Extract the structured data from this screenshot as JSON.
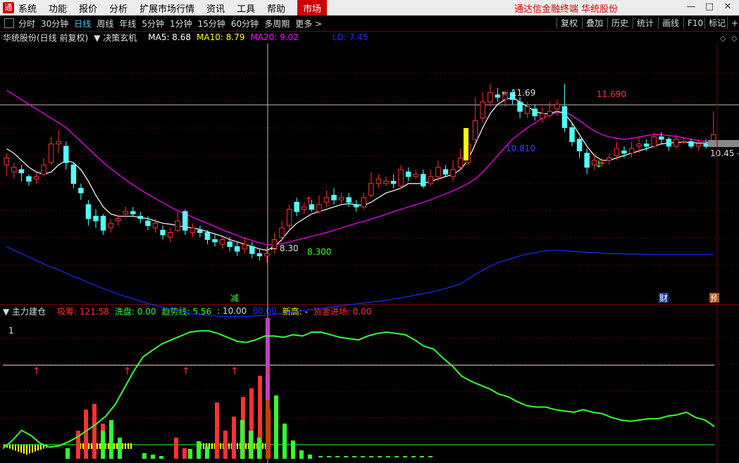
{
  "menu": {
    "items": [
      "系统",
      "功能",
      "报价",
      "分析",
      "扩展市场行情",
      "资讯",
      "工具",
      "帮助"
    ],
    "market": "市场",
    "brand": "通达信金融终端  华统股份"
  },
  "toolbar": {
    "periods": [
      "分时",
      "30分钟",
      "日线",
      "周线",
      "年线",
      "5分钟",
      "1分钟",
      "15分钟",
      "60分钟",
      "多周期",
      "更多 >"
    ],
    "active": "日线",
    "right_buttons": [
      "复权",
      "叠加",
      "历史",
      "统计",
      "画线",
      "F10",
      "标记",
      "+自"
    ]
  },
  "main_info": {
    "title": "华统股份(日线 前复权)",
    "indicator": "决策玄机",
    "ma5": "MA5: 8.68",
    "ma10": "MA10: 8.79",
    "ma20": "MA20: 9.02",
    "ld": "LD: 7.45"
  },
  "price_labels": {
    "high": "11.69",
    "high_red": "11.690",
    "low": "8.30",
    "low_green": "8.300",
    "mid_blue": "10.810",
    "last": "10.45 -",
    "marker_left": "减",
    "marker_cai": "财",
    "marker_yu": "预"
  },
  "sub_info": {
    "title": "主力建仓",
    "xichou": "吸筹: 121.58",
    "xipan": "洗盘: 0.00",
    "qushi": "趋势线: 5.56",
    "ten": ": 10.00",
    "eighty": "80.00",
    "xingao": "新高: -",
    "zijin": "资金进场: 0.00",
    "axis_one": "1"
  },
  "colors": {
    "up": "#ff3232",
    "down": "#54ffff",
    "ma_white": "#ffffff",
    "ma_magenta": "#ff00ff",
    "ld_blue": "#1a2cff",
    "trend_green": "#33ff33",
    "yellow": "#ffff00"
  },
  "chart_data": {
    "type": "candlestick",
    "price_range": [
      7.0,
      12.55
    ],
    "candles": [
      [
        9.95,
        10.1,
        10.2,
        9.7
      ],
      [
        9.8,
        9.9,
        10.0,
        9.65
      ],
      [
        9.85,
        9.78,
        9.95,
        9.6
      ],
      [
        9.7,
        9.6,
        9.75,
        9.5
      ],
      [
        9.65,
        9.7,
        9.8,
        9.55
      ],
      [
        9.75,
        9.95,
        10.1,
        9.7
      ],
      [
        10.0,
        10.4,
        10.55,
        9.95
      ],
      [
        10.4,
        10.45,
        10.7,
        10.2
      ],
      [
        10.35,
        10.0,
        10.45,
        9.85
      ],
      [
        9.95,
        9.55,
        10.0,
        9.45
      ],
      [
        9.45,
        9.35,
        9.55,
        9.2
      ],
      [
        9.1,
        8.8,
        9.2,
        8.65
      ],
      [
        8.85,
        8.75,
        9.0,
        8.6
      ],
      [
        8.85,
        8.55,
        8.9,
        8.45
      ],
      [
        8.6,
        8.7,
        8.8,
        8.5
      ],
      [
        8.75,
        8.8,
        8.9,
        8.65
      ],
      [
        8.9,
        8.95,
        9.05,
        8.8
      ],
      [
        8.95,
        8.9,
        9.05,
        8.85
      ],
      [
        8.85,
        8.8,
        8.95,
        8.7
      ],
      [
        8.75,
        8.65,
        8.85,
        8.55
      ],
      [
        8.6,
        8.7,
        8.8,
        8.5
      ],
      [
        8.55,
        8.45,
        8.65,
        8.35
      ],
      [
        8.4,
        8.5,
        8.6,
        8.3
      ],
      [
        8.55,
        8.75,
        8.95,
        8.5
      ],
      [
        8.95,
        8.55,
        9.0,
        8.45
      ],
      [
        8.5,
        8.6,
        8.7,
        8.4
      ],
      [
        8.55,
        8.5,
        8.65,
        8.4
      ],
      [
        8.5,
        8.35,
        8.55,
        8.25
      ],
      [
        8.35,
        8.3,
        8.45,
        8.2
      ],
      [
        8.25,
        8.35,
        8.4,
        8.15
      ],
      [
        8.3,
        8.2,
        8.4,
        8.1
      ],
      [
        8.2,
        8.1,
        8.3,
        8.0
      ],
      [
        8.15,
        8.25,
        8.4,
        8.05
      ],
      [
        8.2,
        8.05,
        8.3,
        7.95
      ],
      [
        8.05,
        8.0,
        8.15,
        7.9
      ],
      [
        8.0,
        8.05,
        8.2,
        7.85
      ],
      [
        8.15,
        8.35,
        8.5,
        8.05
      ],
      [
        8.4,
        8.6,
        8.75,
        8.3
      ],
      [
        8.65,
        9.0,
        9.1,
        8.55
      ],
      [
        9.15,
        8.95,
        9.25,
        8.85
      ],
      [
        9.0,
        9.05,
        9.15,
        8.9
      ],
      [
        9.1,
        9.0,
        9.2,
        8.95
      ],
      [
        8.95,
        9.1,
        9.3,
        8.9
      ],
      [
        9.15,
        9.25,
        9.4,
        9.05
      ],
      [
        9.3,
        9.2,
        9.45,
        9.1
      ],
      [
        9.2,
        9.25,
        9.35,
        9.1
      ],
      [
        9.25,
        9.15,
        9.35,
        9.05
      ],
      [
        9.1,
        9.05,
        9.2,
        8.95
      ],
      [
        9.05,
        9.25,
        9.35,
        9.0
      ],
      [
        9.3,
        9.55,
        9.8,
        9.25
      ],
      [
        9.55,
        9.65,
        9.75,
        9.45
      ],
      [
        9.55,
        9.6,
        9.7,
        9.5
      ],
      [
        9.6,
        9.55,
        9.75,
        9.45
      ],
      [
        9.5,
        9.85,
        9.95,
        9.45
      ],
      [
        9.8,
        9.7,
        9.9,
        9.6
      ],
      [
        9.7,
        9.75,
        9.85,
        9.65
      ],
      [
        9.75,
        9.5,
        9.85,
        9.45
      ],
      [
        9.55,
        9.7,
        9.85,
        9.5
      ],
      [
        9.7,
        9.9,
        10.05,
        9.6
      ],
      [
        9.85,
        9.75,
        9.95,
        9.7
      ],
      [
        9.7,
        9.85,
        10.05,
        9.6
      ],
      [
        9.9,
        10.1,
        10.3,
        9.85
      ],
      [
        10.0,
        10.4,
        10.65,
        9.95
      ],
      [
        10.5,
        10.9,
        11.4,
        10.4
      ],
      [
        10.95,
        11.3,
        11.5,
        10.85
      ],
      [
        11.3,
        11.5,
        11.69,
        11.2
      ],
      [
        11.45,
        11.4,
        11.6,
        11.3
      ],
      [
        11.35,
        11.45,
        11.55,
        11.2
      ],
      [
        11.5,
        11.35,
        11.55,
        11.25
      ],
      [
        11.3,
        11.1,
        11.4,
        10.95
      ],
      [
        11.05,
        11.2,
        11.3,
        10.95
      ],
      [
        11.15,
        11.0,
        11.25,
        10.9
      ],
      [
        10.95,
        11.05,
        11.2,
        10.85
      ],
      [
        11.0,
        11.1,
        11.3,
        10.95
      ],
      [
        11.15,
        11.25,
        11.35,
        11.0
      ],
      [
        11.2,
        10.75,
        11.69,
        10.65
      ],
      [
        10.75,
        10.45,
        10.85,
        10.35
      ],
      [
        10.5,
        10.25,
        10.55,
        10.1
      ],
      [
        10.2,
        9.9,
        10.3,
        9.75
      ],
      [
        9.95,
        10.05,
        10.2,
        9.85
      ],
      [
        10.0,
        10.0,
        10.1,
        9.9
      ],
      [
        10.05,
        10.1,
        10.2,
        9.95
      ],
      [
        10.15,
        10.3,
        10.45,
        10.05
      ],
      [
        10.25,
        10.2,
        10.35,
        10.1
      ],
      [
        10.2,
        10.3,
        10.45,
        10.1
      ],
      [
        10.35,
        10.4,
        10.55,
        10.2
      ],
      [
        10.4,
        10.35,
        10.5,
        10.25
      ],
      [
        10.35,
        10.55,
        10.65,
        10.3
      ],
      [
        10.55,
        10.5,
        10.65,
        10.4
      ],
      [
        10.5,
        10.35,
        10.55,
        10.25
      ],
      [
        10.35,
        10.5,
        10.6,
        10.3
      ],
      [
        10.45,
        10.45,
        10.55,
        10.4
      ],
      [
        10.45,
        10.35,
        10.5,
        10.3
      ],
      [
        10.35,
        10.4,
        10.5,
        10.25
      ],
      [
        10.4,
        10.35,
        10.5,
        10.3
      ],
      [
        10.4,
        10.6,
        11.1,
        10.4
      ]
    ],
    "ma_white": [
      10.3,
      10.2,
      10.05,
      9.9,
      9.8,
      9.75,
      9.8,
      9.95,
      10.05,
      10.0,
      9.85,
      9.6,
      9.3,
      9.05,
      8.9,
      8.85,
      8.85,
      8.85,
      8.82,
      8.8,
      8.75,
      8.7,
      8.68,
      8.65,
      8.62,
      8.6,
      8.57,
      8.52,
      8.47,
      8.42,
      8.35,
      8.3,
      8.25,
      8.2,
      8.15,
      8.12,
      8.2,
      8.35,
      8.55,
      8.7,
      8.8,
      8.9,
      8.95,
      9.0,
      9.05,
      9.1,
      9.12,
      9.1,
      9.08,
      9.15,
      9.25,
      9.35,
      9.4,
      9.45,
      9.55,
      9.55,
      9.55,
      9.6,
      9.65,
      9.7,
      9.75,
      9.85,
      10.05,
      10.4,
      10.75,
      11.05,
      11.25,
      11.35,
      11.4,
      11.3,
      11.2,
      11.1,
      11.05,
      11.05,
      11.1,
      11.05,
      10.85,
      10.6,
      10.35,
      10.15,
      10.05,
      10.05,
      10.1,
      10.15,
      10.2,
      10.25,
      10.3,
      10.35,
      10.4,
      10.42,
      10.43,
      10.44,
      10.43,
      10.42,
      10.42,
      10.45
    ],
    "ma_magenta": [
      11.55,
      11.45,
      11.35,
      11.25,
      11.15,
      11.05,
      10.95,
      10.85,
      10.75,
      10.6,
      10.45,
      10.3,
      10.15,
      10.0,
      9.87,
      9.75,
      9.63,
      9.52,
      9.42,
      9.32,
      9.23,
      9.14,
      9.05,
      8.97,
      8.9,
      8.83,
      8.76,
      8.7,
      8.63,
      8.56,
      8.5,
      8.44,
      8.38,
      8.33,
      8.28,
      8.24,
      8.24,
      8.26,
      8.3,
      8.34,
      8.38,
      8.42,
      8.46,
      8.5,
      8.55,
      8.6,
      8.65,
      8.7,
      8.74,
      8.79,
      8.84,
      8.89,
      8.95,
      9.0,
      9.05,
      9.1,
      9.15,
      9.2,
      9.27,
      9.33,
      9.4,
      9.47,
      9.55,
      9.65,
      9.8,
      9.97,
      10.15,
      10.33,
      10.5,
      10.63,
      10.75,
      10.85,
      10.95,
      11.03,
      11.07,
      11.1,
      11.0,
      10.9,
      10.78,
      10.68,
      10.6,
      10.55,
      10.52,
      10.5,
      10.52,
      10.55,
      10.58,
      10.6,
      10.6,
      10.58,
      10.56,
      10.53,
      10.5,
      10.47,
      10.45,
      10.45
    ],
    "ld_blue": [
      8.2,
      8.12,
      8.05,
      7.98,
      7.9,
      7.83,
      7.76,
      7.7,
      7.63,
      7.56,
      7.5,
      7.43,
      7.36,
      7.3,
      7.24,
      7.18,
      7.13,
      7.08,
      7.03,
      6.98,
      6.94,
      6.9,
      6.86,
      6.82,
      6.79,
      6.76,
      6.74,
      6.72,
      6.71,
      6.7,
      6.7,
      6.7,
      6.7,
      6.71,
      6.72,
      6.73,
      6.75,
      6.77,
      6.79,
      6.81,
      6.83,
      6.85,
      6.87,
      6.89,
      6.91,
      6.93,
      6.95,
      6.97,
      6.99,
      7.01,
      7.03,
      7.05,
      7.08,
      7.1,
      7.13,
      7.16,
      7.19,
      7.22,
      7.26,
      7.3,
      7.35,
      7.4,
      7.5,
      7.6,
      7.7,
      7.78,
      7.85,
      7.9,
      7.95,
      8.0,
      8.04,
      8.07,
      8.1,
      8.12,
      8.12,
      8.11,
      8.1,
      8.09,
      8.08,
      8.07,
      8.06,
      8.05,
      8.05,
      8.04,
      8.04,
      8.04,
      8.03,
      8.03,
      8.03,
      8.03,
      8.03,
      8.03,
      8.03,
      8.03,
      8.03,
      8.03
    ],
    "sub_range": [
      0,
      110
    ],
    "sub_red_bars": [
      0,
      0,
      0,
      0,
      0,
      0,
      0,
      0,
      0,
      0,
      0,
      0,
      0,
      0,
      38,
      50,
      56,
      40,
      0,
      0,
      0,
      0,
      0,
      0,
      0,
      0,
      0,
      0,
      0,
      0,
      0,
      0,
      30,
      0,
      0,
      0,
      0,
      0,
      0,
      0,
      0,
      0,
      0,
      0,
      0,
      0,
      0,
      0,
      0,
      0,
      0,
      0,
      0,
      0,
      0,
      0,
      0,
      0,
      0,
      0,
      0,
      0,
      0,
      0
    ],
    "sub_trend": [
      8,
      14,
      22,
      18,
      12,
      9,
      10,
      13,
      17,
      22,
      27,
      33,
      42,
      55,
      68,
      79,
      84,
      89,
      92,
      95,
      98,
      99,
      99,
      97,
      94,
      91,
      90,
      92,
      95,
      95,
      94,
      96,
      95,
      98,
      98,
      96,
      94,
      93,
      92,
      95,
      97,
      98,
      97,
      96,
      92,
      87,
      85,
      78,
      72,
      64,
      60,
      57,
      54,
      50,
      48,
      44,
      41,
      40,
      40,
      38,
      37,
      36,
      38,
      36,
      35,
      32,
      30,
      29,
      30,
      31,
      31,
      33,
      34,
      36,
      32,
      30,
      25
    ]
  }
}
